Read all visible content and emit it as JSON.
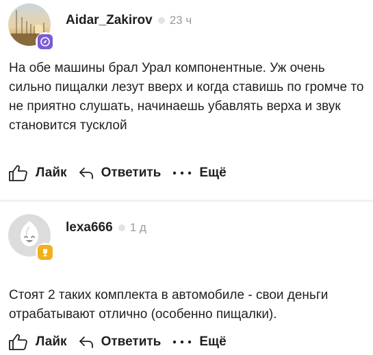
{
  "comments": [
    {
      "username": "Aidar_Zakirov",
      "time": "23 ч",
      "avatar": "sunset-field-photo",
      "badge_icon": "compass-icon",
      "badge_color": "#7b5cd6",
      "text": "На обе машины брал Урал компонентные. Уж очень сильно пищалки лезут вверх и когда ставишь по громче то не приятно слушать, начинаешь убавлять верха и звук становится тусклой",
      "actions": {
        "like": "Лайк",
        "reply": "Ответить",
        "more": "Ещё"
      }
    },
    {
      "username": "lexa666",
      "time": "1 д",
      "avatar": "default-ghost-avatar",
      "badge_icon": "trophy-icon",
      "badge_color": "#f2b01e",
      "text": "Стоят 2 таких комплекта в автомобиле - свои деньги отрабатывают отлично (особенно пищалки).",
      "actions": {
        "like": "Лайк",
        "reply": "Ответить",
        "more": "Ещё"
      }
    }
  ]
}
